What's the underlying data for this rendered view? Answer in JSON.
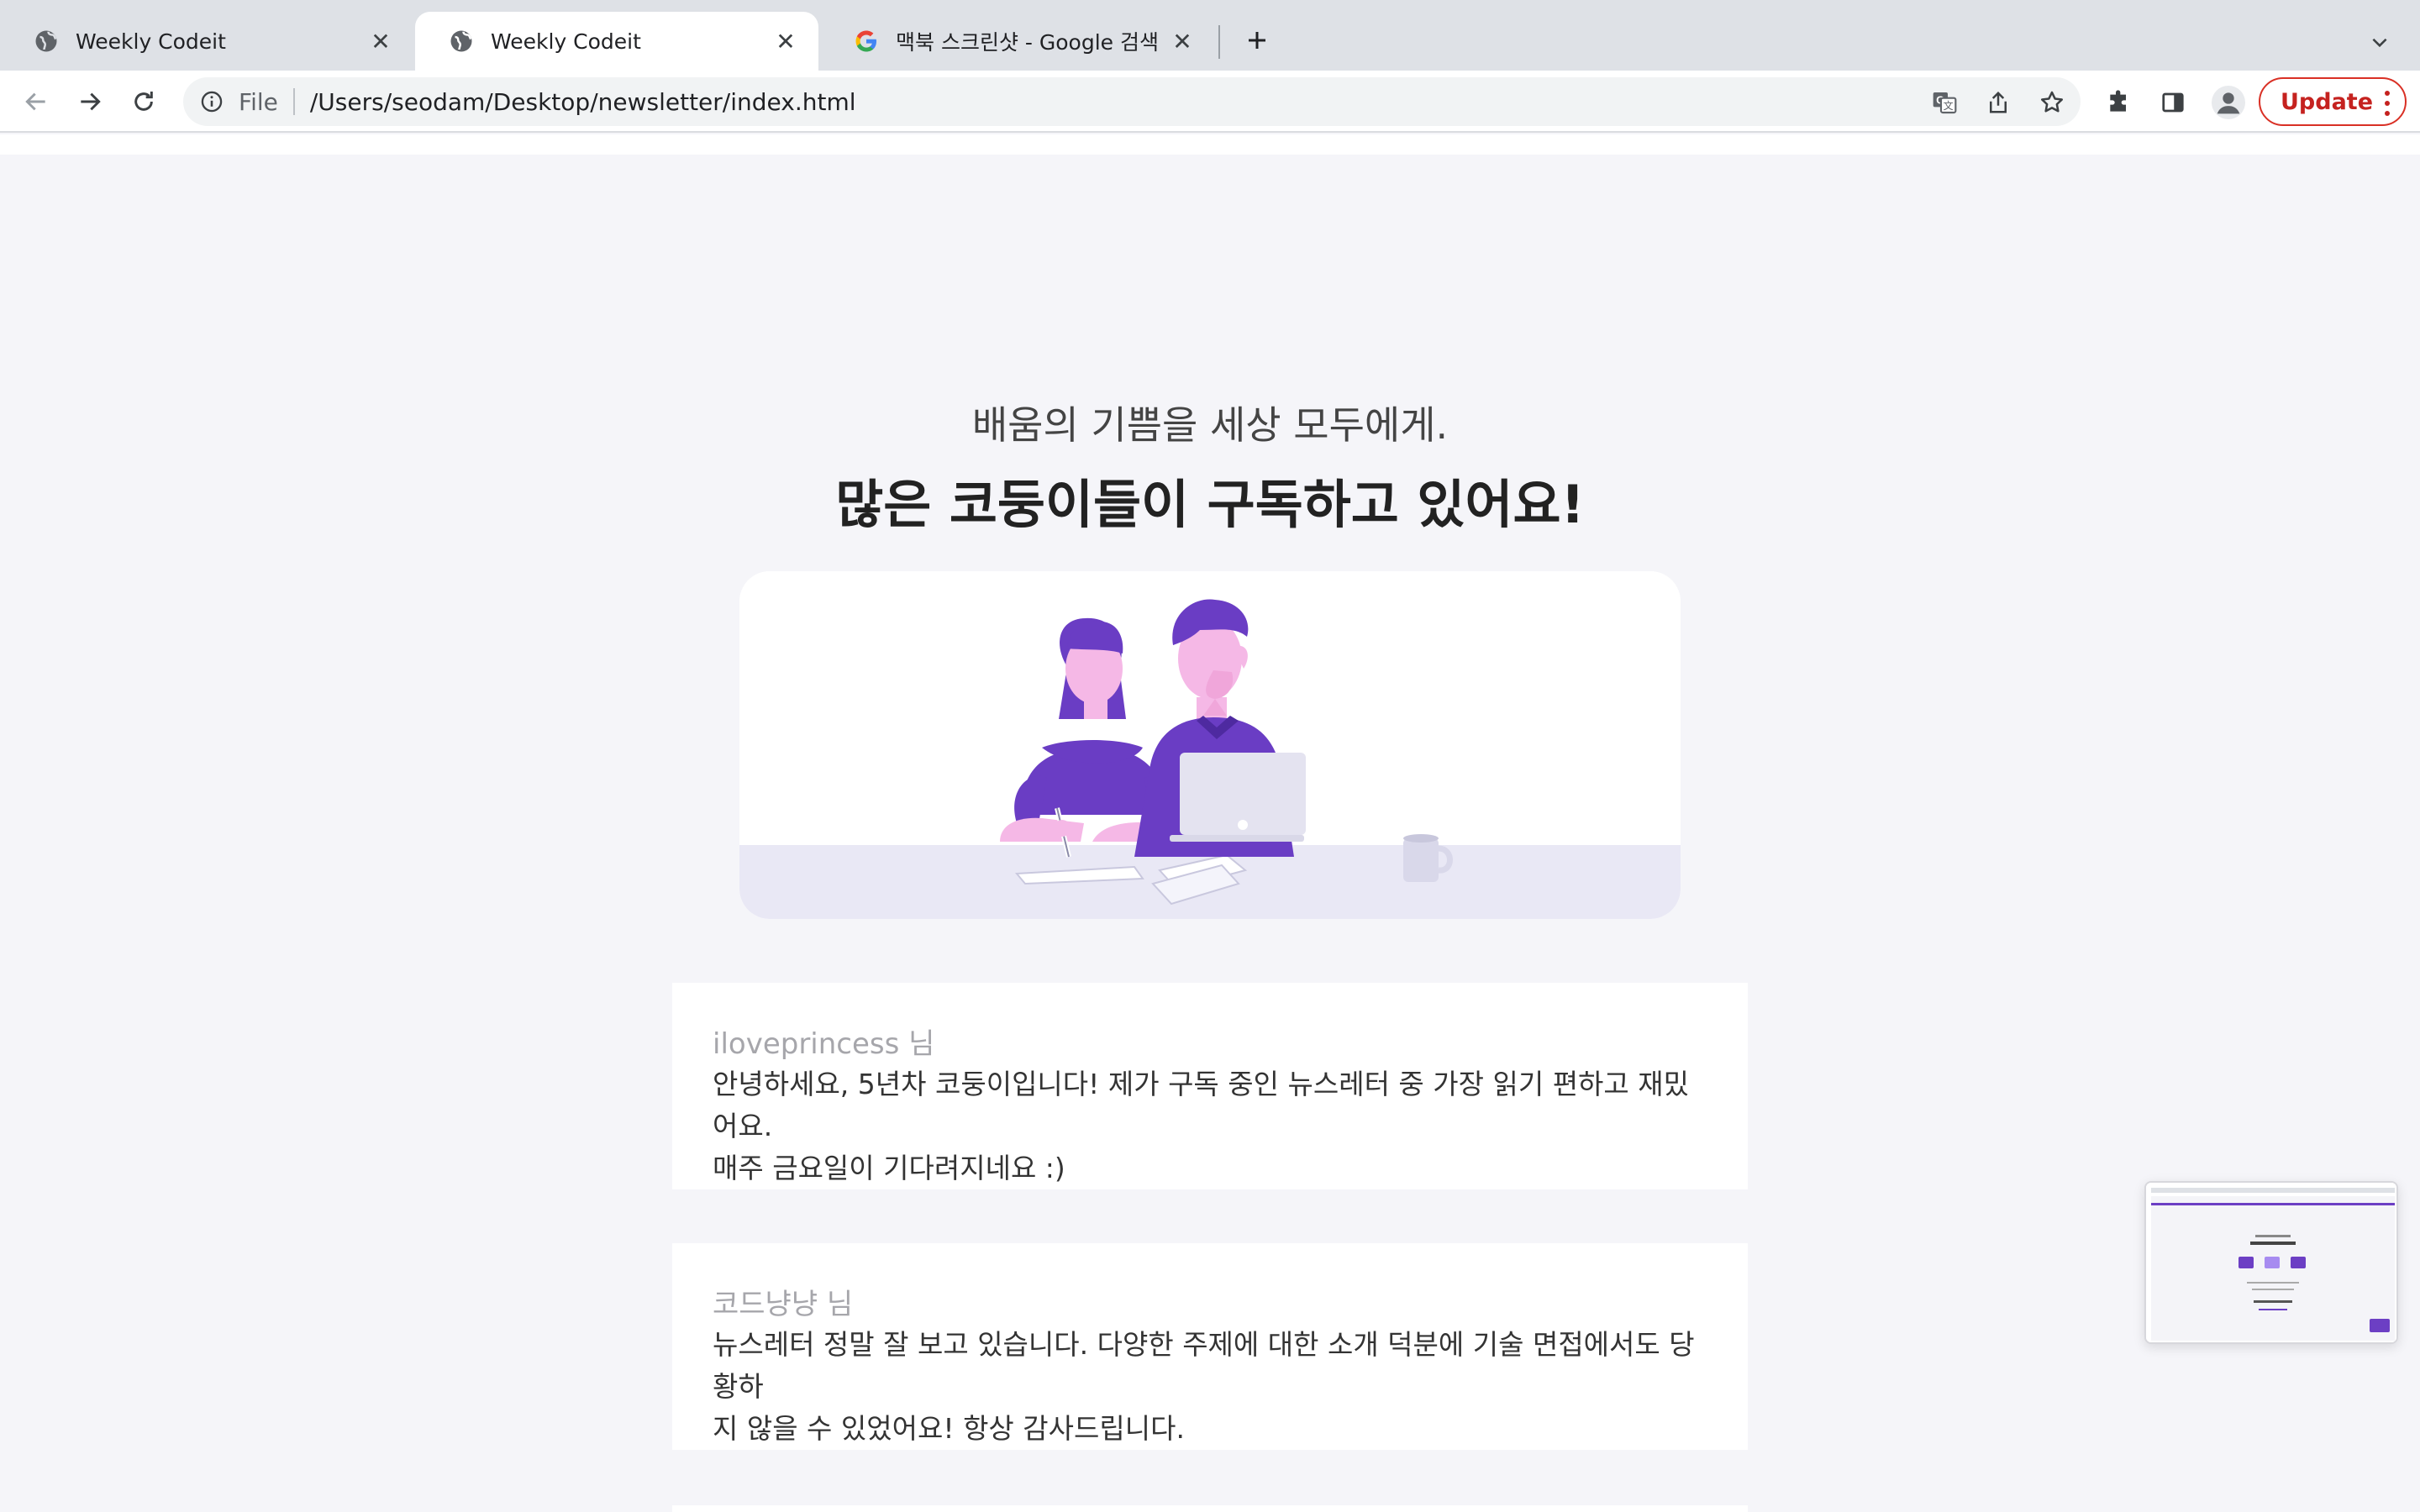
{
  "browser": {
    "tabs": [
      {
        "title": "Weekly Codeit",
        "favicon": "globe-icon",
        "active": false
      },
      {
        "title": "Weekly Codeit",
        "favicon": "globe-icon",
        "active": true
      },
      {
        "title": "맥북 스크린샷 - Google 검색",
        "favicon": "google-g-icon",
        "active": false
      }
    ],
    "address_bar": {
      "scheme_label": "File",
      "url": "/Users/seodam/Desktop/newsletter/index.html"
    },
    "update_label": "Update"
  },
  "page": {
    "subtitle": "배움의 기쁨을 세상 모두에게.",
    "headline": "많은 코둥이들이 구독하고 있어요!",
    "illustration": "two-people-studying-illustration",
    "reviews": [
      {
        "author": "iloveprincess 님",
        "lines": [
          "안녕하세요, 5년차 코둥이입니다! 제가 구독 중인 뉴스레터 중 가장 읽기 편하고 재밌어요.",
          "매주 금요일이 기다려지네요 :)"
        ]
      },
      {
        "author": "코드냥냥 님",
        "lines": [
          "뉴스레터 정말 잘 보고 있습니다. 다양한 주제에 대한 소개 덕분에 기술 면접에서도 당황하",
          "지 않을 수 있었어요! 항상 감사드립니다."
        ]
      }
    ]
  },
  "colors": {
    "brand_purple": "#6c3fc4",
    "skin_pink": "#f4b6e8",
    "page_background": "#f5f5f9",
    "update_red": "#c5221f"
  }
}
